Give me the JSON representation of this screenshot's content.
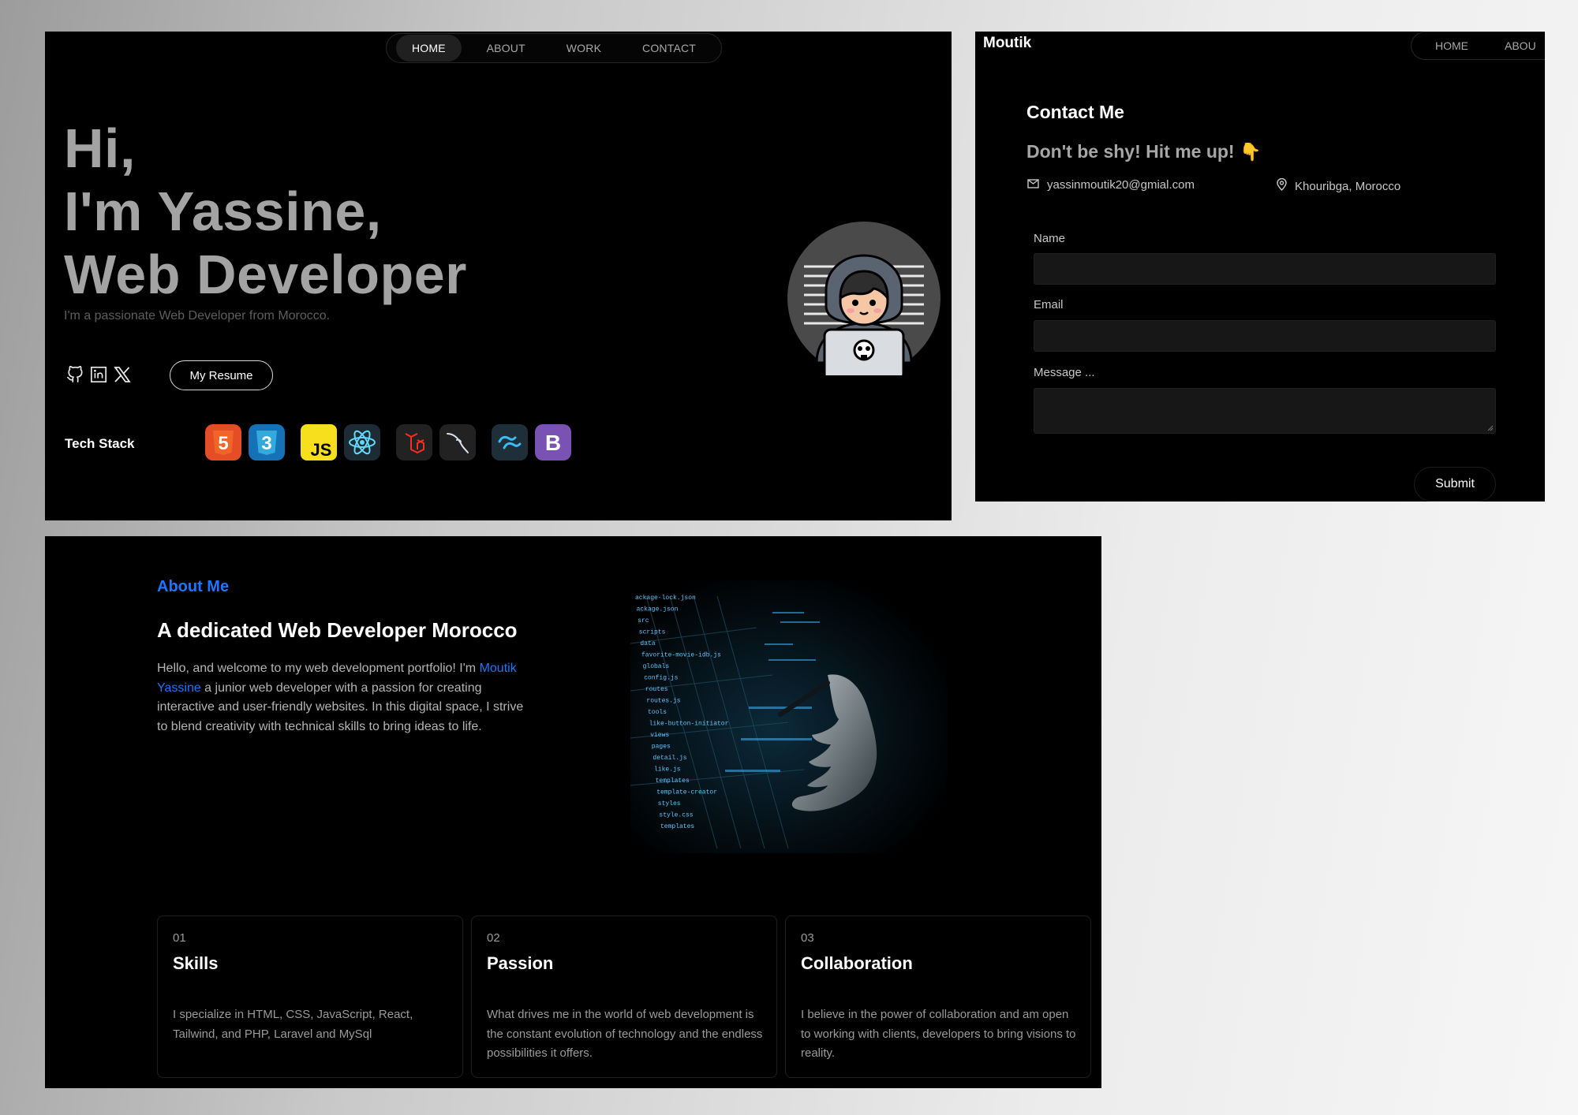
{
  "hero": {
    "nav": [
      "HOME",
      "ABOUT",
      "WORK",
      "CONTACT"
    ],
    "title_line1": "Hi,",
    "title_line2": "I'm Yassine,",
    "title_line3": "Web Developer",
    "subtitle": "I'm a passionate Web Developer from Morocco.",
    "socials": [
      "github-icon",
      "linkedin-icon",
      "x-icon"
    ],
    "resume_label": "My Resume",
    "stack_label": "Tech Stack",
    "tech_stack": [
      {
        "name": "html5-icon",
        "glyph": "5",
        "color": "#e34f26"
      },
      {
        "name": "css3-icon",
        "glyph": "3",
        "color": "#1572b6"
      },
      {
        "name": "javascript-icon",
        "glyph": "JS",
        "color": "#f7df1e"
      },
      {
        "name": "react-icon",
        "glyph": "",
        "color": "#61dafb"
      },
      {
        "name": "laravel-icon",
        "glyph": "",
        "color": "#ff2d20"
      },
      {
        "name": "mysql-icon",
        "glyph": "",
        "color": "#4479a1"
      },
      {
        "name": "tailwind-icon",
        "glyph": "",
        "color": "#38bdf8"
      },
      {
        "name": "bootstrap-icon",
        "glyph": "B",
        "color": "#7952b3"
      }
    ]
  },
  "contact": {
    "brand": "Moutik",
    "nav_home": "HOME",
    "nav_about": "ABOU",
    "heading": "Contact Me",
    "subheading": "Don't be shy! Hit me up!",
    "emoji": "👇",
    "email": "yassinmoutik20@gmial.com",
    "location": "Khouribga, Morocco",
    "name_label": "Name",
    "email_label": "Email",
    "message_label": "Message ...",
    "submit_label": "Submit"
  },
  "about": {
    "label": "About Me",
    "heading": "A dedicated Web Developer Morocco",
    "body_before": "Hello, and welcome to my web development portfolio! I'm ",
    "body_link": "Moutik Yassine",
    "body_after": " a junior web developer with a passion for creating interactive and user-friendly websites. In this digital space, I strive to blend creativity with technical skills to bring ideas to life.",
    "code_lines": [
      "ackage-lock.json",
      "ackage.json",
      "src",
      "scripts",
      "data",
      "favorite-movie-idb.js",
      "globals",
      "config.js",
      "routes",
      "routes.js",
      "tools",
      "like-button-initiator",
      "views",
      "pages",
      "detail.js",
      "like.js",
      "templates",
      "template-creator",
      "styles",
      "style.css",
      "templates"
    ],
    "cards": [
      {
        "num": "01",
        "title": "Skills",
        "text": "I specialize in HTML, CSS, JavaScript, React, Tailwind, and PHP, Laravel and MySql"
      },
      {
        "num": "02",
        "title": "Passion",
        "text": "What drives me in the world of web development is the constant evolution of technology and the endless possibilities it offers."
      },
      {
        "num": "03",
        "title": "Collaboration",
        "text": "I believe in the power of collaboration and am open to working with clients, developers to bring visions to reality."
      }
    ]
  },
  "colors": {
    "accent": "#1e75ff",
    "background": "#000000",
    "muted_text": "#a3a3a3"
  }
}
